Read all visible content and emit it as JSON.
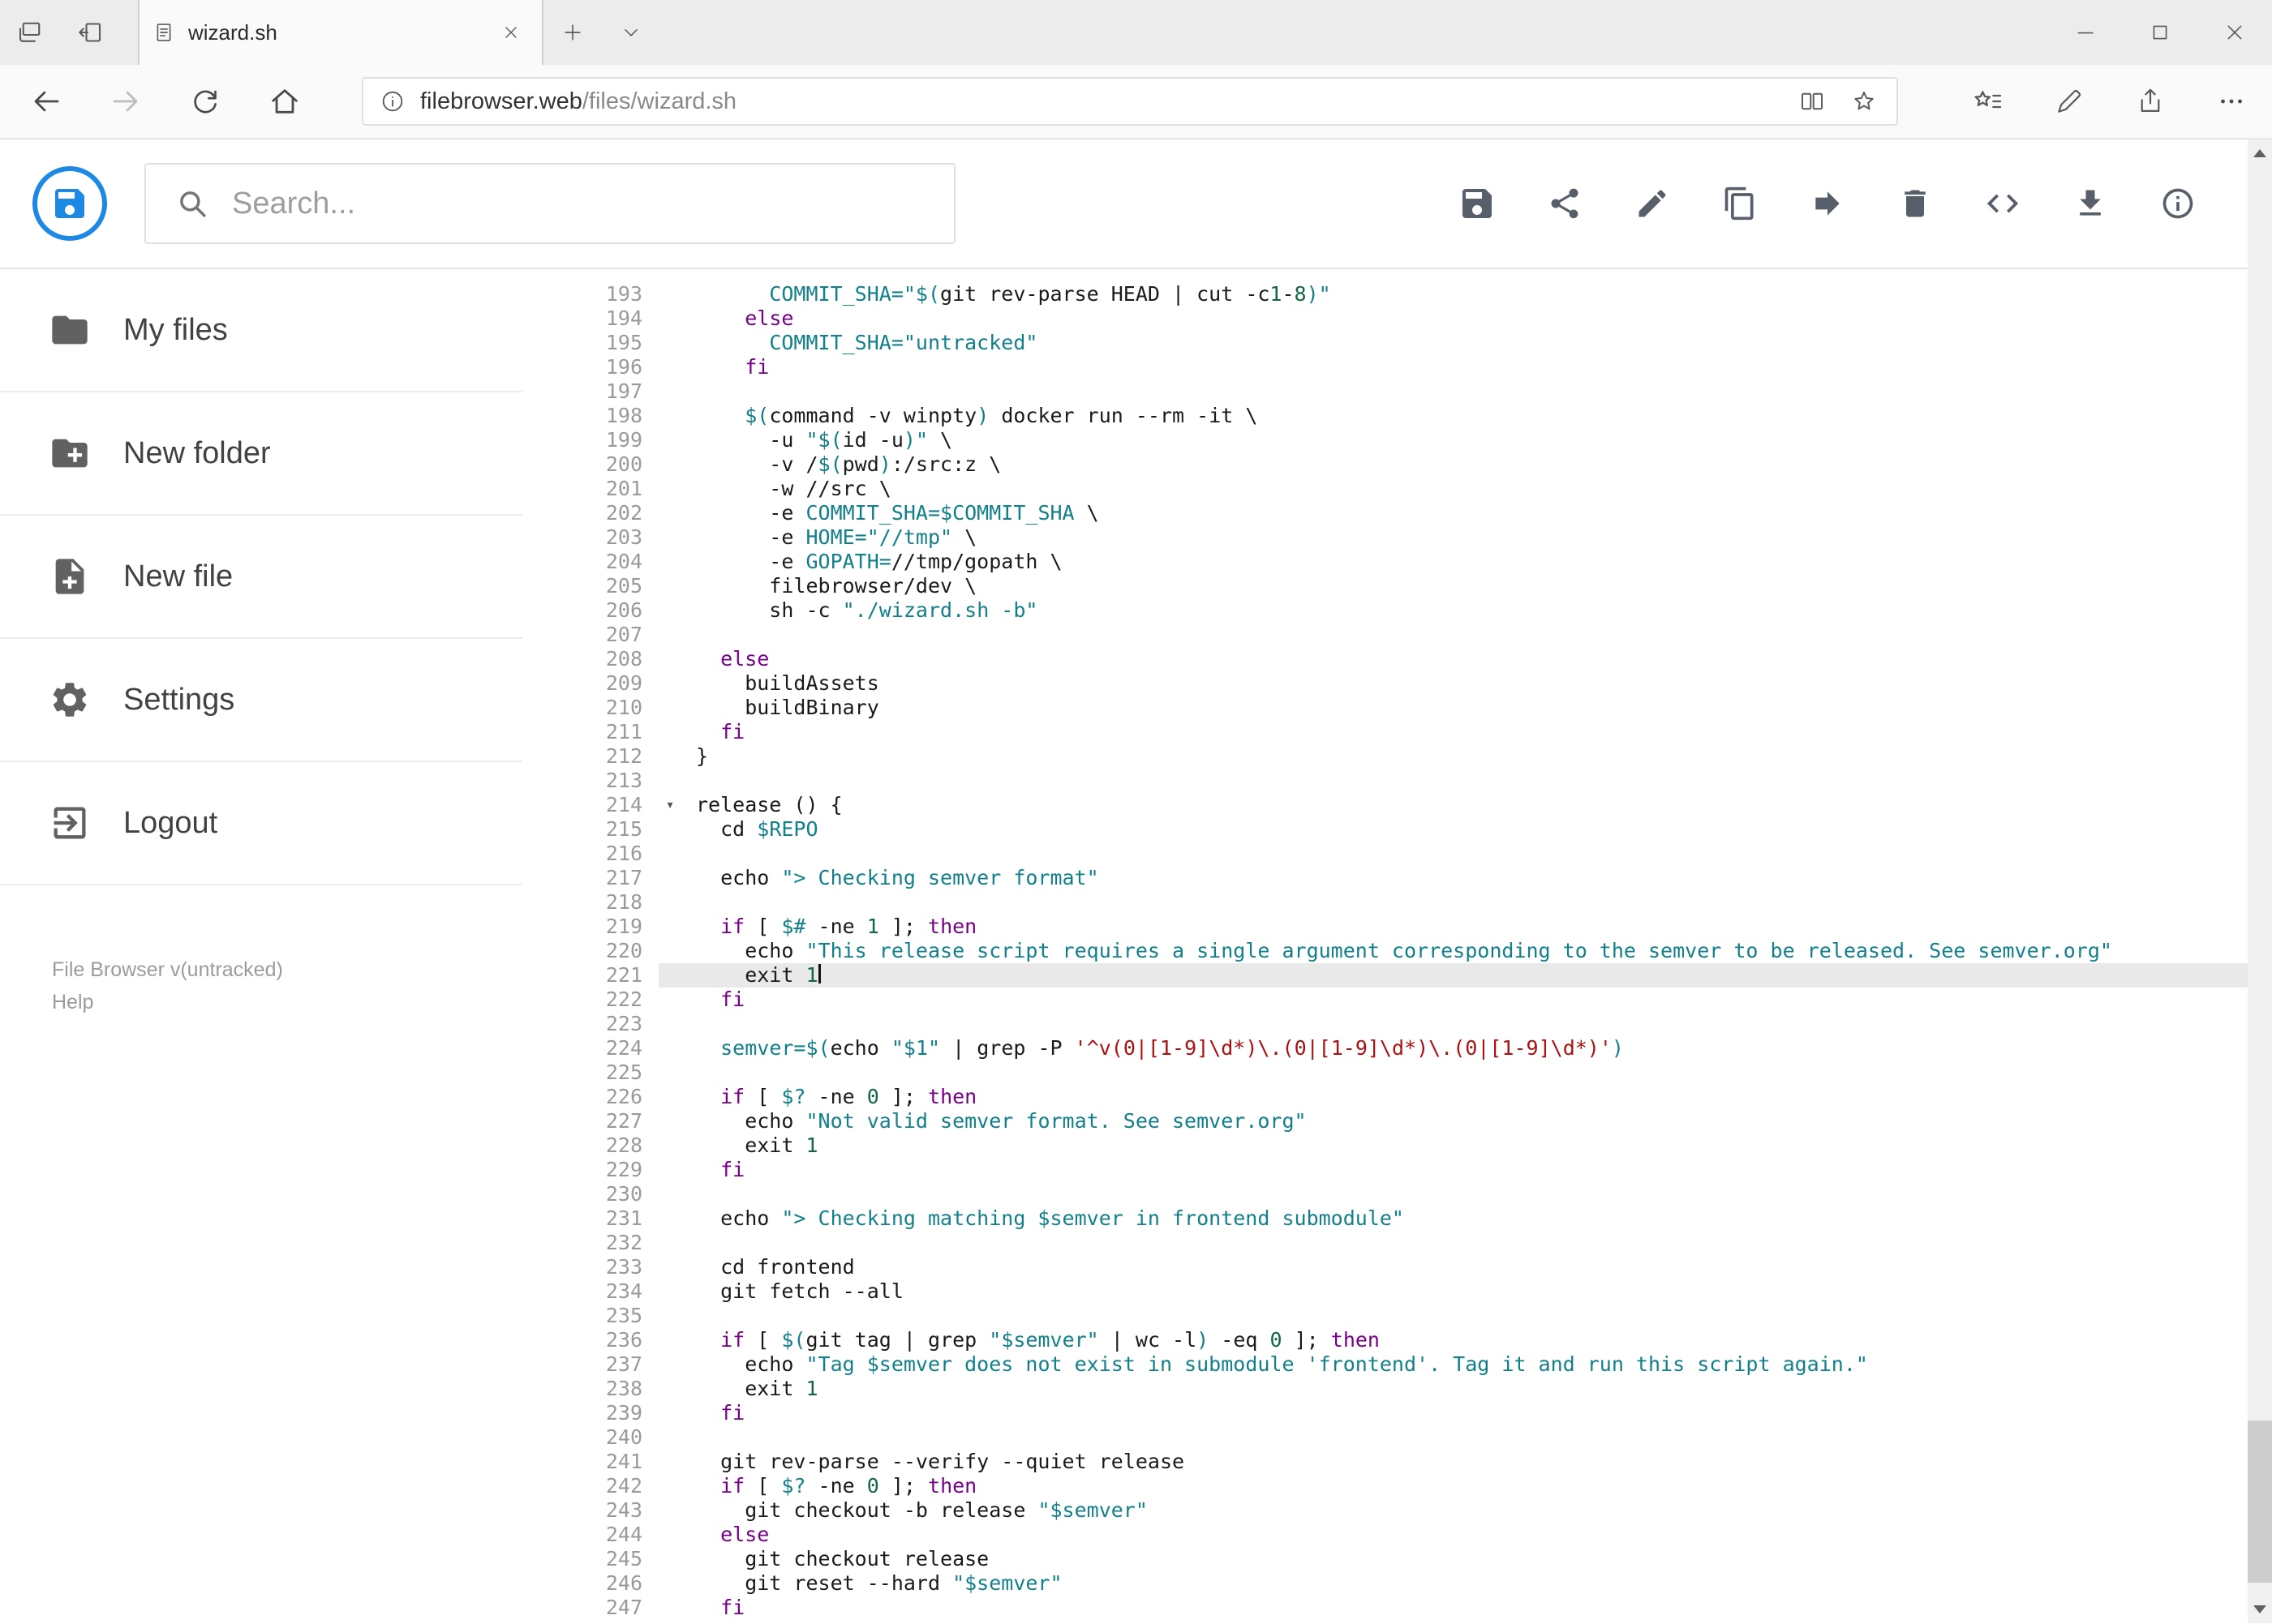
{
  "browser": {
    "tab_title": "wizard.sh",
    "url_host": "filebrowser.web",
    "url_path": "/files/wizard.sh"
  },
  "header": {
    "search_placeholder": "Search..."
  },
  "toolbar": {
    "icons": [
      "save",
      "share",
      "edit",
      "copy",
      "move",
      "delete",
      "code",
      "download",
      "info"
    ]
  },
  "sidebar": {
    "items": [
      "My files",
      "New folder",
      "New file",
      "Settings",
      "Logout"
    ],
    "footer_version": "File Browser v(untracked)",
    "footer_help": "Help"
  },
  "colors": {
    "accent": "#1e88e5",
    "keyword": "#770088",
    "string": "#12808a",
    "number": "#116644",
    "regex_string": "#aa1111",
    "line_number": "#9a9a9a",
    "active_line_bg": "#e9e9e9"
  },
  "editor": {
    "active_line": 221,
    "fold_line": 214,
    "lines": [
      {
        "n": 193,
        "t": [
          [
            "t",
            "      "
          ],
          [
            "s",
            "COMMIT_SHA=\"$("
          ],
          [
            "t",
            "git rev-parse HEAD | cut -c"
          ],
          [
            "n",
            "1"
          ],
          [
            "t",
            "-"
          ],
          [
            "n",
            "8"
          ],
          [
            "s",
            ")\""
          ]
        ]
      },
      {
        "n": 194,
        "t": [
          [
            "t",
            "    "
          ],
          [
            "k",
            "else"
          ]
        ]
      },
      {
        "n": 195,
        "t": [
          [
            "t",
            "      "
          ],
          [
            "s",
            "COMMIT_SHA=\"untracked\""
          ]
        ]
      },
      {
        "n": 196,
        "t": [
          [
            "t",
            "    "
          ],
          [
            "k",
            "fi"
          ]
        ]
      },
      {
        "n": 197,
        "t": []
      },
      {
        "n": 198,
        "t": [
          [
            "t",
            "    "
          ],
          [
            "s",
            "$("
          ],
          [
            "t",
            "command -v winpty"
          ],
          [
            "s",
            ")"
          ],
          [
            "t",
            " docker run --rm -it \\"
          ]
        ]
      },
      {
        "n": 199,
        "t": [
          [
            "t",
            "      -u "
          ],
          [
            "s",
            "\"$("
          ],
          [
            "t",
            "id -u"
          ],
          [
            "s",
            ")\""
          ],
          [
            "t",
            " \\"
          ]
        ]
      },
      {
        "n": 200,
        "t": [
          [
            "t",
            "      -v /"
          ],
          [
            "s",
            "$("
          ],
          [
            "t",
            "pwd"
          ],
          [
            "s",
            ")"
          ],
          [
            "t",
            ":/src:z \\"
          ]
        ]
      },
      {
        "n": 201,
        "t": [
          [
            "t",
            "      -w //src \\"
          ]
        ]
      },
      {
        "n": 202,
        "t": [
          [
            "t",
            "      -e "
          ],
          [
            "s",
            "COMMIT_SHA=$COMMIT_SHA"
          ],
          [
            "t",
            " \\"
          ]
        ]
      },
      {
        "n": 203,
        "t": [
          [
            "t",
            "      -e "
          ],
          [
            "s",
            "HOME=\"//tmp\""
          ],
          [
            "t",
            " \\"
          ]
        ]
      },
      {
        "n": 204,
        "t": [
          [
            "t",
            "      -e "
          ],
          [
            "s",
            "GOPATH="
          ],
          [
            "t",
            "//tmp/gopath \\"
          ]
        ]
      },
      {
        "n": 205,
        "t": [
          [
            "t",
            "      filebrowser/dev \\"
          ]
        ]
      },
      {
        "n": 206,
        "t": [
          [
            "t",
            "      sh -c "
          ],
          [
            "s",
            "\"./wizard.sh -b\""
          ]
        ]
      },
      {
        "n": 207,
        "t": []
      },
      {
        "n": 208,
        "t": [
          [
            "t",
            "  "
          ],
          [
            "k",
            "else"
          ]
        ]
      },
      {
        "n": 209,
        "t": [
          [
            "t",
            "    buildAssets"
          ]
        ]
      },
      {
        "n": 210,
        "t": [
          [
            "t",
            "    buildBinary"
          ]
        ]
      },
      {
        "n": 211,
        "t": [
          [
            "t",
            "  "
          ],
          [
            "k",
            "fi"
          ]
        ]
      },
      {
        "n": 212,
        "t": [
          [
            "t",
            "}"
          ]
        ]
      },
      {
        "n": 213,
        "t": []
      },
      {
        "n": 214,
        "t": [
          [
            "t",
            "release () {"
          ]
        ]
      },
      {
        "n": 215,
        "t": [
          [
            "t",
            "  cd "
          ],
          [
            "s",
            "$REPO"
          ]
        ]
      },
      {
        "n": 216,
        "t": []
      },
      {
        "n": 217,
        "t": [
          [
            "t",
            "  echo "
          ],
          [
            "s",
            "\"> Checking semver format\""
          ]
        ]
      },
      {
        "n": 218,
        "t": []
      },
      {
        "n": 219,
        "t": [
          [
            "t",
            "  "
          ],
          [
            "k",
            "if"
          ],
          [
            "t",
            " [ "
          ],
          [
            "s",
            "$#"
          ],
          [
            "t",
            " -ne "
          ],
          [
            "n",
            "1"
          ],
          [
            "t",
            " ]; "
          ],
          [
            "k",
            "then"
          ]
        ]
      },
      {
        "n": 220,
        "t": [
          [
            "t",
            "    echo "
          ],
          [
            "s",
            "\"This release script requires a single argument corresponding to the semver to be released. See semver.org\""
          ]
        ]
      },
      {
        "n": 221,
        "t": [
          [
            "t",
            "    exit "
          ],
          [
            "n",
            "1"
          ]
        ]
      },
      {
        "n": 222,
        "t": [
          [
            "t",
            "  "
          ],
          [
            "k",
            "fi"
          ]
        ]
      },
      {
        "n": 223,
        "t": []
      },
      {
        "n": 224,
        "t": [
          [
            "t",
            "  "
          ],
          [
            "s",
            "semver=$("
          ],
          [
            "t",
            "echo "
          ],
          [
            "s",
            "\"$1\""
          ],
          [
            "t",
            " | grep -P "
          ],
          [
            "r",
            "'^v(0|[1-9]\\d*)\\.(0|[1-9]\\d*)\\.(0|[1-9]\\d*)'"
          ],
          [
            "s",
            ")"
          ]
        ]
      },
      {
        "n": 225,
        "t": []
      },
      {
        "n": 226,
        "t": [
          [
            "t",
            "  "
          ],
          [
            "k",
            "if"
          ],
          [
            "t",
            " [ "
          ],
          [
            "s",
            "$?"
          ],
          [
            "t",
            " -ne "
          ],
          [
            "n",
            "0"
          ],
          [
            "t",
            " ]; "
          ],
          [
            "k",
            "then"
          ]
        ]
      },
      {
        "n": 227,
        "t": [
          [
            "t",
            "    echo "
          ],
          [
            "s",
            "\"Not valid semver format. See semver.org\""
          ]
        ]
      },
      {
        "n": 228,
        "t": [
          [
            "t",
            "    exit "
          ],
          [
            "n",
            "1"
          ]
        ]
      },
      {
        "n": 229,
        "t": [
          [
            "t",
            "  "
          ],
          [
            "k",
            "fi"
          ]
        ]
      },
      {
        "n": 230,
        "t": []
      },
      {
        "n": 231,
        "t": [
          [
            "t",
            "  echo "
          ],
          [
            "s",
            "\"> Checking matching $semver in frontend submodule\""
          ]
        ]
      },
      {
        "n": 232,
        "t": []
      },
      {
        "n": 233,
        "t": [
          [
            "t",
            "  cd frontend"
          ]
        ]
      },
      {
        "n": 234,
        "t": [
          [
            "t",
            "  git fetch --all"
          ]
        ]
      },
      {
        "n": 235,
        "t": []
      },
      {
        "n": 236,
        "t": [
          [
            "t",
            "  "
          ],
          [
            "k",
            "if"
          ],
          [
            "t",
            " [ "
          ],
          [
            "s",
            "$("
          ],
          [
            "t",
            "git tag | grep "
          ],
          [
            "s",
            "\"$semver\""
          ],
          [
            "t",
            " | wc -l"
          ],
          [
            "s",
            ")"
          ],
          [
            "t",
            " -eq "
          ],
          [
            "n",
            "0"
          ],
          [
            "t",
            " ]; "
          ],
          [
            "k",
            "then"
          ]
        ]
      },
      {
        "n": 237,
        "t": [
          [
            "t",
            "    echo "
          ],
          [
            "s",
            "\"Tag $semver does not exist in submodule 'frontend'. Tag it and run this script again.\""
          ]
        ]
      },
      {
        "n": 238,
        "t": [
          [
            "t",
            "    exit "
          ],
          [
            "n",
            "1"
          ]
        ]
      },
      {
        "n": 239,
        "t": [
          [
            "t",
            "  "
          ],
          [
            "k",
            "fi"
          ]
        ]
      },
      {
        "n": 240,
        "t": []
      },
      {
        "n": 241,
        "t": [
          [
            "t",
            "  git rev-parse --verify --quiet release"
          ]
        ]
      },
      {
        "n": 242,
        "t": [
          [
            "t",
            "  "
          ],
          [
            "k",
            "if"
          ],
          [
            "t",
            " [ "
          ],
          [
            "s",
            "$?"
          ],
          [
            "t",
            " -ne "
          ],
          [
            "n",
            "0"
          ],
          [
            "t",
            " ]; "
          ],
          [
            "k",
            "then"
          ]
        ]
      },
      {
        "n": 243,
        "t": [
          [
            "t",
            "    git checkout -b release "
          ],
          [
            "s",
            "\"$semver\""
          ]
        ]
      },
      {
        "n": 244,
        "t": [
          [
            "t",
            "  "
          ],
          [
            "k",
            "else"
          ]
        ]
      },
      {
        "n": 245,
        "t": [
          [
            "t",
            "    git checkout release"
          ]
        ]
      },
      {
        "n": 246,
        "t": [
          [
            "t",
            "    git reset --hard "
          ],
          [
            "s",
            "\"$semver\""
          ]
        ]
      },
      {
        "n": 247,
        "t": [
          [
            "t",
            "  "
          ],
          [
            "k",
            "fi"
          ]
        ]
      }
    ]
  }
}
